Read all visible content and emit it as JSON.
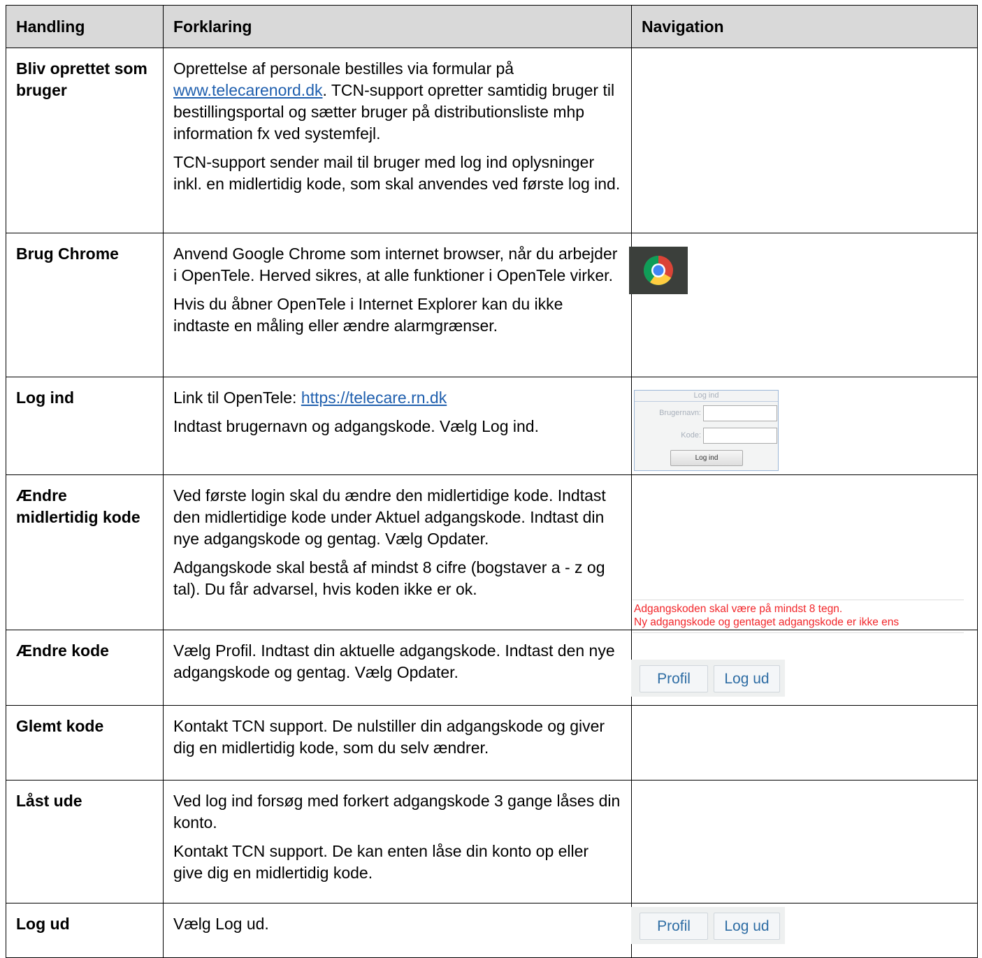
{
  "headers": {
    "handling": "Handling",
    "forklaring": "Forklaring",
    "navigation": "Navigation"
  },
  "rows": [
    {
      "action": "Bliv oprettet som bruger",
      "p1_before": "Oprettelse af personale bestilles via formular på ",
      "p1_link": "www.telecarenord.dk",
      "p1_after": ". TCN-support opretter samtidig bruger til bestillingsportal og sætter bruger på distributionsliste mhp information fx ved systemfejl.",
      "p2": "TCN-support sender mail til bruger med log ind oplysninger inkl. en midlertidig kode, som skal anvendes ved første log ind."
    },
    {
      "action": "Brug Chrome",
      "p1": "Anvend Google Chrome som internet browser, når du arbejder i OpenTele. Herved sikres, at alle funktioner i OpenTele virker.",
      "p2": "Hvis du åbner OpenTele i Internet Explorer kan du ikke indtaste en måling eller ændre alarmgrænser.",
      "icon": "chrome-icon"
    },
    {
      "action": "Log ind",
      "p1_before": "Link til OpenTele: ",
      "p1_link": "https://telecare.rn.dk",
      "p2": "Indtast brugernavn og adgangskode. Vælg Log ind.",
      "login_form": {
        "title": "Log ind",
        "username_label": "Brugernavn:",
        "password_label": "Kode:",
        "button": "Log ind"
      }
    },
    {
      "action": "Ændre midlertidig kode",
      "p1": "Ved første login skal du ændre den midlertidige kode. Indtast den midlertidige kode under Aktuel adgangskode. Indtast din nye adgangskode og gentag. Vælg Opdater.",
      "p2": "Adgangskode skal bestå af mindst 8 cifre (bogstaver a - z og tal). Du får advarsel, hvis koden ikke er ok.",
      "warnings": [
        "Adgangskoden skal være på mindst 8 tegn.",
        "Ny adgangskode og gentaget adgangskode er ikke ens"
      ],
      "warning_color": "#f2262a"
    },
    {
      "action": "Ændre kode",
      "p1": "Vælg Profil. Indtast din aktuelle adgangskode. Indtast den nye adgangskode og gentag. Vælg Opdater.",
      "buttons": {
        "profil": "Profil",
        "logud": "Log ud"
      }
    },
    {
      "action": "Glemt kode",
      "p1": "Kontakt TCN support. De nulstiller din adgangskode og giver dig en midlertidig kode, som du selv ændrer."
    },
    {
      "action": "Låst ude",
      "p1": "Ved log ind forsøg med forkert adgangskode 3 gange låses din konto.",
      "p2": "Kontakt TCN support. De kan enten låse din konto op eller give dig en midlertidig kode."
    },
    {
      "action": "Log ud",
      "p1": "Vælg Log ud.",
      "buttons": {
        "profil": "Profil",
        "logud": "Log ud"
      }
    }
  ],
  "colors": {
    "header_bg": "#d9d9d9",
    "link": "#1f5fae",
    "button_text": "#2e6da4"
  }
}
